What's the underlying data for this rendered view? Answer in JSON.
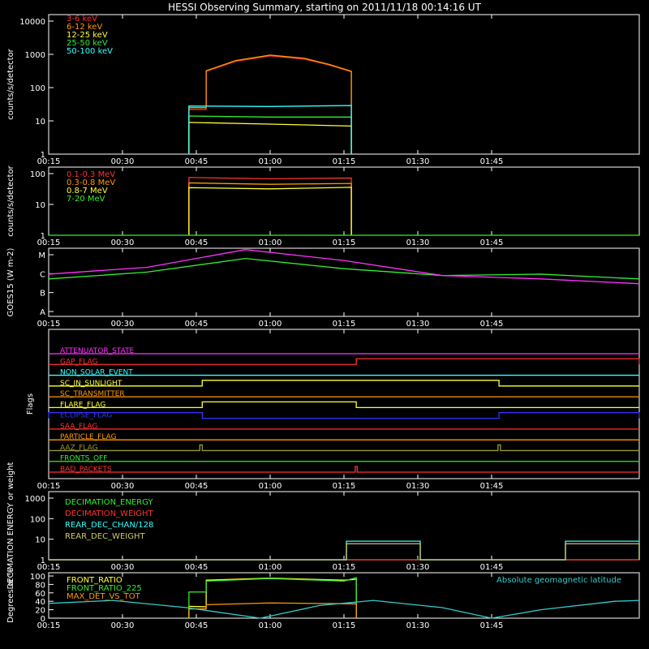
{
  "title": "HESSI Observing Summary, starting on 2011/11/18 00:14:16 UT",
  "time_ticks": [
    "00:15",
    "00:30",
    "00:45",
    "01:00",
    "01:15",
    "01:30",
    "01:45"
  ],
  "chart_data": [
    {
      "type": "line",
      "panel": "lightcurves-low",
      "ylabel": "counts/s/detector",
      "yscale": "log",
      "ylim": [
        1,
        10000
      ],
      "yticks": [
        "1",
        "10",
        "100",
        "1000",
        "10000"
      ],
      "series": [
        {
          "name": "3-6 keV",
          "color": "#ff3030",
          "points": [
            [
              28.5,
              1
            ],
            [
              28.5,
              22
            ],
            [
              32.0,
              22
            ],
            [
              32.0,
              310
            ],
            [
              38,
              620
            ],
            [
              45,
              900
            ],
            [
              52,
              720
            ],
            [
              57,
              480
            ],
            [
              61.5,
              300
            ],
            [
              61.5,
              1
            ]
          ]
        },
        {
          "name": "6-12 keV",
          "color": "#ff9900",
          "points": [
            [
              28.5,
              1
            ],
            [
              28.5,
              25
            ],
            [
              32.0,
              25
            ],
            [
              32.0,
              320
            ],
            [
              38,
              650
            ],
            [
              45,
              950
            ],
            [
              52,
              760
            ],
            [
              57,
              500
            ],
            [
              61.5,
              310
            ],
            [
              61.5,
              1
            ]
          ]
        },
        {
          "name": "12-25 keV",
          "color": "#ffff33",
          "points": [
            [
              28.5,
              1
            ],
            [
              28.5,
              9
            ],
            [
              45,
              8
            ],
            [
              61.5,
              7
            ],
            [
              61.5,
              1
            ]
          ]
        },
        {
          "name": "25-50 keV",
          "color": "#33ee33",
          "points": [
            [
              28.5,
              1
            ],
            [
              28.5,
              14
            ],
            [
              45,
              13
            ],
            [
              61.5,
              13
            ],
            [
              61.5,
              1
            ]
          ]
        },
        {
          "name": "50-100 keV",
          "color": "#33ffff",
          "points": [
            [
              28.5,
              1
            ],
            [
              28.5,
              28
            ],
            [
              45,
              27
            ],
            [
              61.5,
              29
            ],
            [
              61.5,
              1
            ]
          ]
        }
      ]
    },
    {
      "type": "line",
      "panel": "lightcurves-high",
      "ylabel": "counts/s/detector",
      "yscale": "log",
      "ylim": [
        1,
        100
      ],
      "yticks": [
        "1",
        "10",
        "100"
      ],
      "series": [
        {
          "name": "0.1-0.3 MeV",
          "color": "#ff3030",
          "points": [
            [
              28.5,
              1
            ],
            [
              28.5,
              75
            ],
            [
              45,
              68
            ],
            [
              61.5,
              72
            ],
            [
              61.5,
              1
            ]
          ]
        },
        {
          "name": "0.3-0.8 MeV",
          "color": "#ff9900",
          "points": [
            [
              28.5,
              1
            ],
            [
              28.5,
              50
            ],
            [
              45,
              45
            ],
            [
              61.5,
              48
            ],
            [
              61.5,
              1
            ]
          ]
        },
        {
          "name": "0.8-7 MeV",
          "color": "#ffff33",
          "points": [
            [
              28.5,
              1
            ],
            [
              28.5,
              35
            ],
            [
              45,
              32
            ],
            [
              61.5,
              36
            ],
            [
              61.5,
              1
            ]
          ]
        },
        {
          "name": "7-20 MeV",
          "color": "#33ee33",
          "points": [
            [
              0,
              1
            ],
            [
              120,
              1
            ]
          ]
        }
      ]
    },
    {
      "type": "line",
      "panel": "goes",
      "ylabel": "GOES15 (W m-2)",
      "yscale": "log",
      "yticks": [
        "A",
        "B",
        "C",
        "M"
      ],
      "series": [
        {
          "color": "#33ee33",
          "points": [
            [
              0,
              0.55
            ],
            [
              20,
              0.65
            ],
            [
              40,
              0.85
            ],
            [
              60,
              0.7
            ],
            [
              80,
              0.6
            ],
            [
              100,
              0.62
            ],
            [
              120,
              0.55
            ]
          ]
        },
        {
          "color": "#ff33ff",
          "points": [
            [
              0,
              0.62
            ],
            [
              20,
              0.72
            ],
            [
              40,
              0.98
            ],
            [
              60,
              0.82
            ],
            [
              80,
              0.6
            ],
            [
              100,
              0.55
            ],
            [
              120,
              0.48
            ]
          ]
        }
      ]
    },
    {
      "type": "line",
      "panel": "flags",
      "ylabel": "Flags",
      "series": [
        {
          "name": "ATTENUATOR_STATE",
          "color": "#ff33ff",
          "steps": []
        },
        {
          "name": "GAP_FLAG",
          "color": "#ff3030",
          "steps": [
            [
              62.5,
              120
            ]
          ]
        },
        {
          "name": "NON_SOLAR_EVENT",
          "color": "#33ffff",
          "steps": []
        },
        {
          "name": "SC_IN_SUNLIGHT",
          "color": "#ffff33",
          "steps": [
            [
              31.2,
              91.5
            ]
          ]
        },
        {
          "name": "SC_TRANSMITTER",
          "color": "#ff9900",
          "steps": []
        },
        {
          "name": "FLARE_FLAG",
          "color": "#ffff33",
          "steps": [
            [
              31.2,
              62.5
            ]
          ]
        },
        {
          "name": "ECLIPSE_FLAG",
          "color": "#3333ff",
          "steps": [
            [
              0,
              31.2
            ],
            [
              91.5,
              120
            ]
          ]
        },
        {
          "name": "SAA_FLAG",
          "color": "#ff3030",
          "steps": []
        },
        {
          "name": "PARTICLE_FLAG",
          "color": "#ff9900",
          "steps": []
        },
        {
          "name": "AAZ_FLAG",
          "color": "#999933",
          "steps": [
            [
              30.7,
              31.2
            ],
            [
              91.3,
              91.8
            ]
          ]
        },
        {
          "name": "FRONTS_OFF",
          "color": "#33ee33",
          "steps": []
        },
        {
          "name": "BAD_PACKETS",
          "color": "#ff3030",
          "steps": [
            [
              62.3,
              62.7
            ]
          ]
        }
      ]
    },
    {
      "type": "line",
      "panel": "decimation",
      "ylabel": "DECIMATION ENERGY or weight",
      "yscale": "log",
      "ylim": [
        1,
        1000
      ],
      "yticks": [
        "1",
        "10",
        "100",
        "1000"
      ],
      "series": [
        {
          "name": "DECIMATION_ENERGY",
          "color": "#33ee33",
          "points": [
            [
              0,
              1
            ],
            [
              120,
              1
            ]
          ]
        },
        {
          "name": "DECIMATION_WEIGHT",
          "color": "#ff3030",
          "points": [
            [
              0,
              1
            ],
            [
              120,
              1
            ]
          ]
        },
        {
          "name": "REAR_DEC_CHAN/128",
          "color": "#33ffff",
          "steps": [
            [
              60.5,
              75.5,
              8
            ],
            [
              105,
              120,
              8
            ]
          ]
        },
        {
          "name": "REAR_DEC_WEIGHT",
          "color": "#cccc66",
          "steps": [
            [
              60.5,
              75.5,
              6
            ],
            [
              105,
              120,
              6
            ]
          ]
        }
      ]
    },
    {
      "type": "line",
      "panel": "ratios",
      "ylabel": "Degrees or %",
      "ylim": [
        0,
        100
      ],
      "yticks": [
        "0",
        "20",
        "40",
        "60",
        "80",
        "100"
      ],
      "annotation": "Absolute geomagnetic latitude",
      "series": [
        {
          "name": "FRONT_RATIO",
          "color": "#ffff33",
          "points": [
            [
              28.5,
              0
            ],
            [
              28.5,
              28
            ],
            [
              32,
              27
            ],
            [
              32,
              90
            ],
            [
              45,
              95
            ],
            [
              60,
              90
            ],
            [
              62.5,
              92
            ],
            [
              62.5,
              0
            ]
          ]
        },
        {
          "name": "FRONT_RATIO_225",
          "color": "#33ee33",
          "points": [
            [
              28.5,
              0
            ],
            [
              28.5,
              62
            ],
            [
              32,
              62
            ],
            [
              32,
              88
            ],
            [
              45,
              94
            ],
            [
              60,
              88
            ],
            [
              62.5,
              96
            ],
            [
              62.5,
              0
            ]
          ]
        },
        {
          "name": "MAX_DET_VS_TOT",
          "color": "#ff9900",
          "points": [
            [
              28.5,
              0
            ],
            [
              28.5,
              22
            ],
            [
              32,
              22
            ],
            [
              32,
              32
            ],
            [
              45,
              36
            ],
            [
              62.5,
              34
            ],
            [
              62.5,
              0
            ]
          ]
        },
        {
          "name": "Absolute geomagnetic latitude",
          "color": "#33cccc",
          "points": [
            [
              0,
              35
            ],
            [
              13,
              42
            ],
            [
              28,
              25
            ],
            [
              43,
              0
            ],
            [
              55,
              30
            ],
            [
              66,
              42
            ],
            [
              80,
              25
            ],
            [
              90,
              0
            ],
            [
              100,
              20
            ],
            [
              115,
              40
            ],
            [
              120,
              42
            ]
          ]
        }
      ]
    }
  ]
}
